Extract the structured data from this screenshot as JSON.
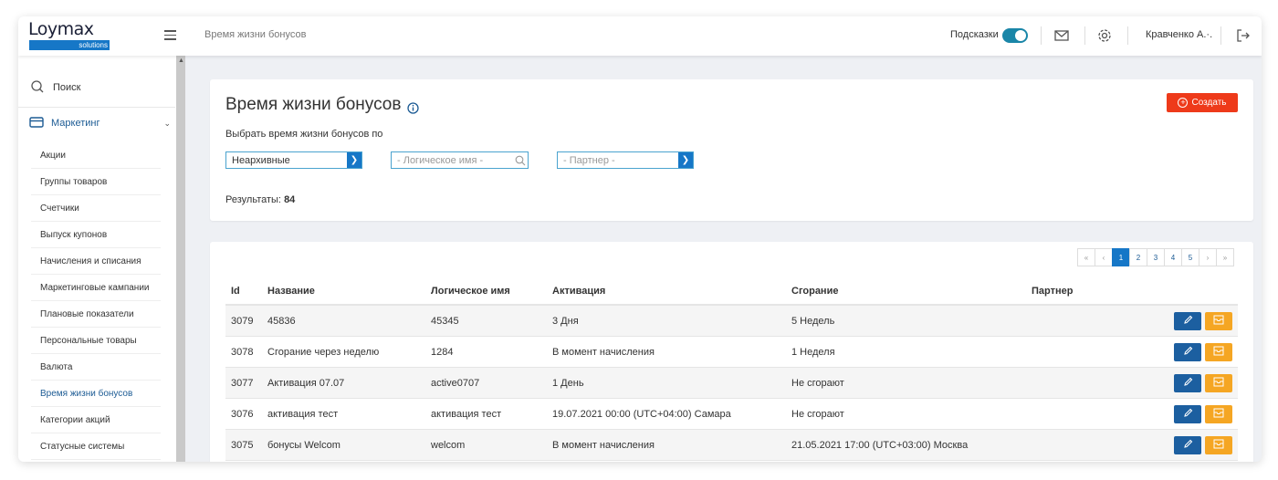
{
  "brand": {
    "logo_word": "Loymax",
    "logo_sub": "solutions",
    "accent": "#1677c7"
  },
  "topbar": {
    "breadcrumb": "Время жизни бонусов",
    "hints_label": "Подсказки",
    "hints_enabled": true,
    "user_name": "Кравченко А.·."
  },
  "sidebar": {
    "search_label": "Поиск",
    "section_label": "Маркетинг",
    "items": [
      {
        "label": "Акции",
        "active": false
      },
      {
        "label": "Группы товаров",
        "active": false
      },
      {
        "label": "Счетчики",
        "active": false
      },
      {
        "label": "Выпуск купонов",
        "active": false
      },
      {
        "label": "Начисления и списания",
        "active": false
      },
      {
        "label": "Маркетинговые кампании",
        "active": false
      },
      {
        "label": "Плановые показатели",
        "active": false
      },
      {
        "label": "Персональные товары",
        "active": false
      },
      {
        "label": "Валюта",
        "active": false
      },
      {
        "label": "Время жизни бонусов",
        "active": true
      },
      {
        "label": "Категории акций",
        "active": false
      },
      {
        "label": "Статусные системы",
        "active": false
      }
    ]
  },
  "header_card": {
    "title": "Время жизни бонусов",
    "create_label": "Создать",
    "filter_label": "Выбрать время жизни бонусов по",
    "filter_archive_value": "Неархивные",
    "filter_logical_placeholder": "- Логическое имя -",
    "filter_partner_placeholder": "- Партнер -",
    "results_label": "Результаты:",
    "results_count": "84"
  },
  "pagination": {
    "first": "«",
    "prev": "‹",
    "pages": [
      "1",
      "2",
      "3",
      "4",
      "5"
    ],
    "active_page": "1",
    "next": "›",
    "last": "»"
  },
  "table": {
    "columns": {
      "id": "Id",
      "name": "Название",
      "logical": "Логическое имя",
      "activation": "Активация",
      "expiry": "Сгорание",
      "partner": "Партнер"
    },
    "rows": [
      {
        "id": "3079",
        "name": "45836",
        "logical": "45345",
        "activation": "3 Дня",
        "expiry": "5 Недель",
        "partner": ""
      },
      {
        "id": "3078",
        "name": "Сгорание через неделю",
        "logical": "1284",
        "activation": "В момент начисления",
        "expiry": "1 Неделя",
        "partner": ""
      },
      {
        "id": "3077",
        "name": "Активация 07.07",
        "logical": "active0707",
        "activation": "1 День",
        "expiry": "Не сгорают",
        "partner": ""
      },
      {
        "id": "3076",
        "name": "активация тест",
        "logical": "активация тест",
        "activation": "19.07.2021 00:00 (UTC+04:00) Самара",
        "expiry": "Не сгорают",
        "partner": ""
      },
      {
        "id": "3075",
        "name": "бонусы Welcom",
        "logical": "welcom",
        "activation": "В момент начисления",
        "expiry": "21.05.2021 17:00 (UTC+03:00) Москва",
        "partner": ""
      }
    ]
  }
}
